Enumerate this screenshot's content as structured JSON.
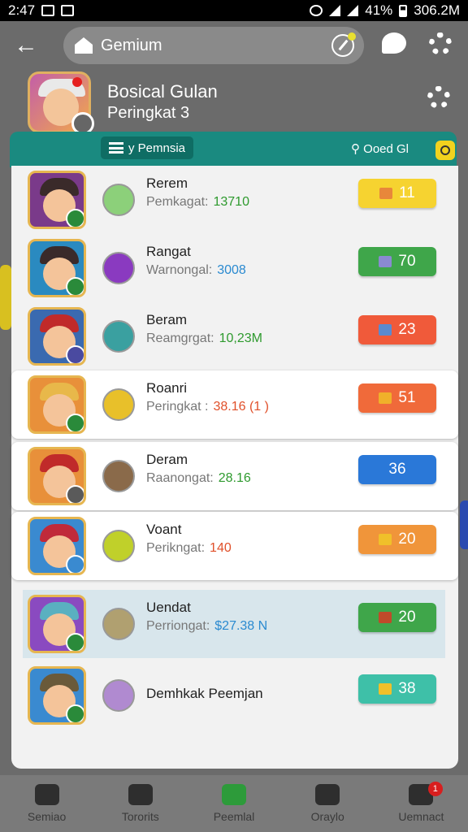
{
  "status_bar": {
    "time": "2:47",
    "battery": "41%",
    "clock_right": "306.2M"
  },
  "search": {
    "text": "Gemium"
  },
  "profile": {
    "name": "Bosical Gulan",
    "rank": "Peringkat 3"
  },
  "tab": {
    "label": "y Pemnsia",
    "filter": "Ooed Gl"
  },
  "players": [
    {
      "name": "Rerem",
      "rank_label": "Pemkagat:",
      "rank_value": "13710",
      "rank_color": "#2e9a2e",
      "score": "11",
      "pill_color": "#f6d330",
      "gem_color": "#e8873a",
      "hair": "#3a2a2a",
      "avatar_bg": "#7a3a8a",
      "badge_color": "#2a8a3a",
      "level_color": "#8cd07a"
    },
    {
      "name": "Rangat",
      "rank_label": "Warnongal:",
      "rank_value": "3008",
      "rank_color": "#2a8ad0",
      "score": "70",
      "pill_color": "#3fa64a",
      "gem_color": "#8a8ad0",
      "hair": "#3a2a2a",
      "avatar_bg": "#2a8ac0",
      "badge_color": "#2a8a3a",
      "level_color": "#8a3ac0"
    },
    {
      "name": "Beram",
      "rank_label": "Reamgrgat:",
      "rank_value": "10,23M",
      "rank_color": "#2e9a2e",
      "score": "23",
      "pill_color": "#f05a3a",
      "gem_color": "#5a8ad0",
      "hair": "#c02a2a",
      "avatar_bg": "#3a6ab0",
      "badge_color": "#4a4aa0",
      "level_color": "#3aa0a0"
    },
    {
      "name": "Roanri",
      "rank_label": "Peringkat :",
      "rank_value": "38.16 (1 )",
      "rank_color": "#e0502a",
      "score": "51",
      "pill_color": "#f06a3a",
      "gem_color": "#f0b02a",
      "hair": "#e8b84a",
      "avatar_bg": "#e8903a",
      "badge_color": "#2a8a3a",
      "level_color": "#e8c02a"
    },
    {
      "name": "Deram",
      "rank_label": "Raanongat:",
      "rank_value": "28.16",
      "rank_color": "#2e9a2e",
      "score": "36",
      "pill_color": "#2a78d8",
      "gem_color": "",
      "hair": "#c02a2a",
      "avatar_bg": "#e8903a",
      "badge_color": "#5a5a5a",
      "level_color": "#8a6a4a"
    },
    {
      "name": "Voant",
      "rank_label": "Perikngat:",
      "rank_value": "140",
      "rank_color": "#e0502a",
      "score": "20",
      "pill_color": "#f0953a",
      "gem_color": "#f0c02a",
      "hair": "#c02a3a",
      "avatar_bg": "#3a8ad0",
      "badge_color": "#3a8ad0",
      "level_color": "#c0d02a"
    },
    {
      "name": "Uendat",
      "rank_label": "Perriongat:",
      "rank_value": "$27.38 N",
      "rank_color": "#2a8ad0",
      "score": "20",
      "pill_color": "#3fa64a",
      "gem_color": "#c04a2a",
      "hair": "#5ab0c0",
      "avatar_bg": "#8a4ac0",
      "badge_color": "#2a8a3a",
      "level_color": "#b0a070"
    },
    {
      "name": "Demhkak Peemjan",
      "rank_label": "",
      "rank_value": "",
      "rank_color": "#777",
      "score": "38",
      "pill_color": "#3ec0a8",
      "gem_color": "#f0c02a",
      "hair": "#6a5a3a",
      "avatar_bg": "#3a8ad0",
      "badge_color": "#2a8a3a",
      "level_color": "#b08ad0"
    }
  ],
  "nav": [
    {
      "label": "Semiao",
      "icon": "home-icon"
    },
    {
      "label": "Tororits",
      "icon": "person-icon"
    },
    {
      "label": "Peemlal",
      "icon": "leaderboard-icon"
    },
    {
      "label": "Oraylo",
      "icon": "friends-icon"
    },
    {
      "label": "Uemnact",
      "icon": "inbox-icon",
      "badge": "1"
    }
  ]
}
